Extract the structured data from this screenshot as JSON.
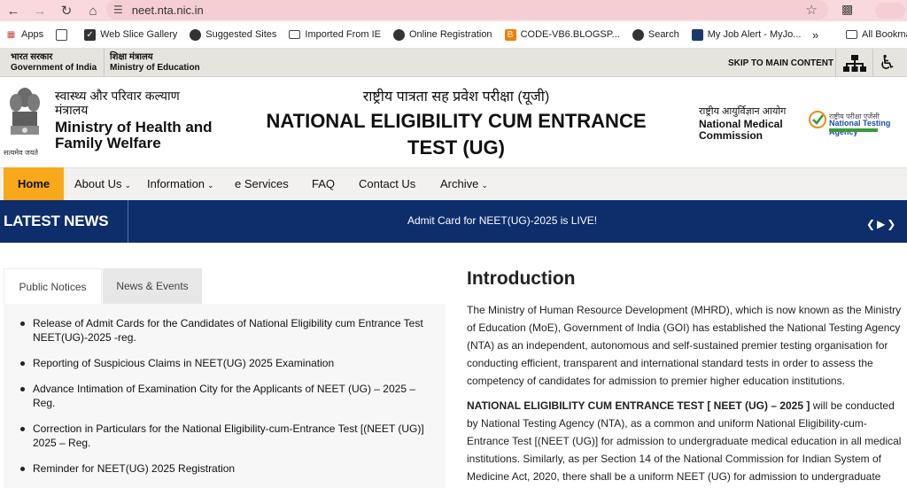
{
  "browser": {
    "url": "neet.nta.nic.in",
    "bookmarks": [
      {
        "label": "Apps",
        "icon": "apps-grid-icon"
      },
      {
        "label": "",
        "icon": "tab-grid-icon"
      },
      {
        "label": "Web Slice Gallery",
        "icon": "web-slice-icon"
      },
      {
        "label": "Suggested Sites",
        "icon": "globe-icon"
      },
      {
        "label": "Imported From IE",
        "icon": "folder-icon"
      },
      {
        "label": "Online Registration",
        "icon": "globe-icon"
      },
      {
        "label": "CODE-VB6.BLOGSP...",
        "icon": "blogger-icon"
      },
      {
        "label": "Search",
        "icon": "globe-icon"
      },
      {
        "label": "My Job Alert - MyJo...",
        "icon": "bookmark-page-icon"
      }
    ],
    "overflow": "»",
    "all_bookmarks": "All Bookma"
  },
  "gov_strip": {
    "gov_hindi": "भारत सरकार",
    "gov_english": "Government of India",
    "ministry_hindi": "शिक्षा मंत्रालय",
    "ministry_english": "Ministry of Education",
    "skip": "SKIP TO MAIN CONTENT"
  },
  "header": {
    "ministry_hindi": "स्वास्थ्य और परिवार कल्याण मंत्रालय",
    "ministry_name": "Ministry of Health and Family Welfare",
    "motto": "सत्यमेव जयते",
    "exam_hindi": "राष्ट्रीय पात्रता सह प्रवेश परीक्षा (यूजी)",
    "exam_name": "NATIONAL ELIGIBILITY CUM ENTRANCE TEST (UG)",
    "nmc_hindi": "राष्ट्रीय आयुर्विज्ञान आयोग",
    "nmc_name": "National Medical Commission",
    "nta_hindi": "राष्ट्रीय परीक्षा एजेंसी",
    "nta_name": "National Testing Agency"
  },
  "nav": {
    "home": "Home",
    "about": "About Us",
    "information": "Information",
    "eservices": "e Services",
    "faq": "FAQ",
    "contact": "Contact Us",
    "archive": "Archive"
  },
  "ticker": {
    "label": "LATEST NEWS",
    "news": "Admit Card for NEET(UG)-2025 is LIVE!"
  },
  "notices": {
    "tab_public": "Public Notices",
    "tab_news": "News & Events",
    "items": [
      "Release of Admit Cards for the Candidates of National Eligibility cum Entrance Test NEET(UG)-2025 -reg.",
      "Reporting of Suspicious Claims in NEET(UG) 2025 Examination",
      "Advance Intimation of Examination City for the Applicants of NEET (UG) – 2025 – Reg.",
      "Correction in Particulars for the National Eligibility-cum-Entrance Test [(NEET (UG)] 2025 – Reg.",
      "Reminder for NEET(UG) 2025 Registration"
    ]
  },
  "intro": {
    "title": "Introduction",
    "para1": "The Ministry of Human Resource Development (MHRD), which is now known as the Ministry of Education (MoE), Government of India (GOI) has established the National Testing Agency (NTA) as an independent, autonomous and self-sustained premier testing organisation for conducting efficient, transparent and international standard tests in order to assess the competency of candidates for admission to premier higher education institutions.",
    "para2_bold": "NATIONAL ELIGIBILITY CUM ENTRANCE TEST [ NEET (UG) – 2025 ]",
    "para2_rest": " will be conducted by National Testing Agency (NTA), as a common and uniform National Eligibility-cum-Entrance Test [(NEET (UG)] for admission to undergraduate medical education in all medical institutions. Similarly, as per Section 14 of the National Commission for Indian System of Medicine Act, 2020, there shall be a uniform NEET (UG) for admission to undergraduate"
  }
}
